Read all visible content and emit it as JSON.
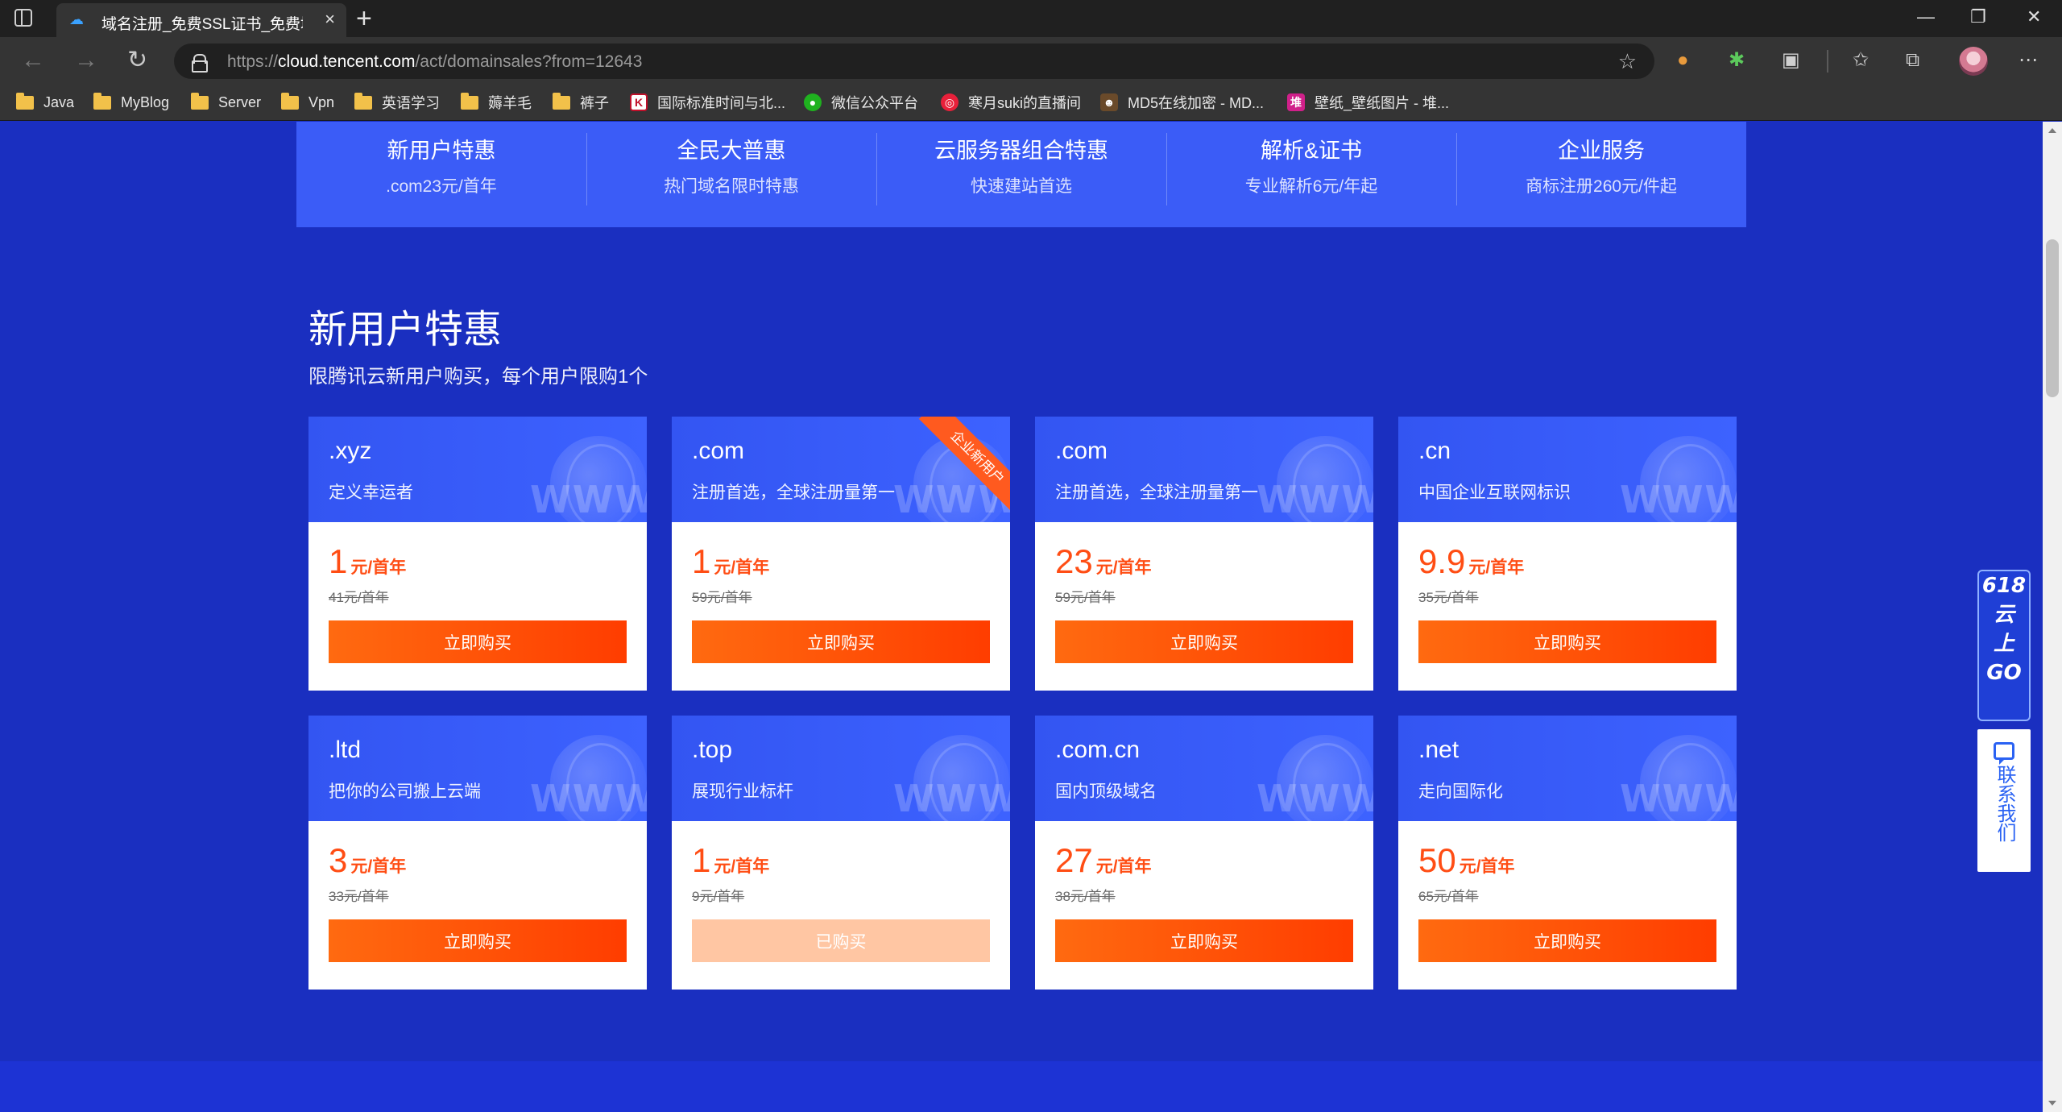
{
  "browser": {
    "tab_title": "域名注册_免费SSL证书_免费域名",
    "tab_close": "×",
    "new_tab": "+",
    "window": {
      "minimize": "—",
      "restore": "❐",
      "close": "✕"
    },
    "nav": {
      "back": "←",
      "forward": "→",
      "reload": "↻"
    },
    "url_scheme": "https://",
    "url_host": "cloud.tencent.com",
    "url_path": "/act/domainsales?from=12643",
    "bookmarks": [
      {
        "label": "Java",
        "icon": "folder-icon"
      },
      {
        "label": "MyBlog",
        "icon": "folder-icon"
      },
      {
        "label": "Server",
        "icon": "folder-icon"
      },
      {
        "label": "Vpn",
        "icon": "folder-icon"
      },
      {
        "label": "英语学习",
        "icon": "folder-icon"
      },
      {
        "label": "薅羊毛",
        "icon": "folder-icon"
      },
      {
        "label": "裤子",
        "icon": "folder-icon"
      },
      {
        "label": "国际标准时间与北...",
        "icon": "k-site-icon"
      },
      {
        "label": "微信公众平台",
        "icon": "wechat-icon"
      },
      {
        "label": "寒月suki的直播间",
        "icon": "live-icon"
      },
      {
        "label": "MD5在线加密 - MD...",
        "icon": "md5-site-icon"
      },
      {
        "label": "壁纸_壁纸图片 - 堆...",
        "icon": "wallpaper-site-icon"
      }
    ]
  },
  "category_nav": [
    {
      "title": "新用户特惠",
      "sub": ".com23元/首年"
    },
    {
      "title": "全民大普惠",
      "sub": "热门域名限时特惠"
    },
    {
      "title": "云服务器组合特惠",
      "sub": "快速建站首选"
    },
    {
      "title": "解析&证书",
      "sub": "专业解析6元/年起"
    },
    {
      "title": "企业服务",
      "sub": "商标注册260元/件起"
    }
  ],
  "section": {
    "title": "新用户特惠",
    "subtitle": "限腾讯云新用户购买，每个用户限购1个"
  },
  "cards": [
    {
      "domain": ".xyz",
      "desc": "定义幸运者",
      "price": "1",
      "unit": "元/首年",
      "orig": "41元/首年",
      "button": "立即购买",
      "watermark": "WWW"
    },
    {
      "domain": ".com",
      "desc": "注册首选，全球注册量第一",
      "price": "1",
      "unit": "元/首年",
      "orig": "59元/首年",
      "button": "立即购买",
      "ribbon": "企业新用户",
      "watermark": "WWW"
    },
    {
      "domain": ".com",
      "desc": "注册首选，全球注册量第一",
      "price": "23",
      "unit": "元/首年",
      "orig": "59元/首年",
      "button": "立即购买",
      "watermark": "WWW"
    },
    {
      "domain": ".cn",
      "desc": "中国企业互联网标识",
      "price": "9.9",
      "unit": "元/首年",
      "orig": "35元/首年",
      "button": "立即购买",
      "watermark": "WWW"
    },
    {
      "domain": ".ltd",
      "desc": "把你的公司搬上云端",
      "price": "3",
      "unit": "元/首年",
      "orig": "33元/首年",
      "button": "立即购买",
      "watermark": "WWW"
    },
    {
      "domain": ".top",
      "desc": "展现行业标杆",
      "price": "1",
      "unit": "元/首年",
      "orig": "9元/首年",
      "button": "已购买",
      "watermark": "WWW"
    },
    {
      "domain": ".com.cn",
      "desc": "国内顶级域名",
      "price": "27",
      "unit": "元/首年",
      "orig": "38元/首年",
      "button": "立即购买",
      "watermark": "WWW"
    },
    {
      "domain": ".net",
      "desc": "走向国际化",
      "price": "50",
      "unit": "元/首年",
      "orig": "65元/首年",
      "button": "立即购买",
      "watermark": "WWW"
    }
  ],
  "float": {
    "promo_lines": [
      "618",
      "云",
      "上",
      "GO"
    ],
    "contact": "联系我们"
  },
  "colors": {
    "page_bg": "#1a2fc0",
    "card_head": "#3b5cf7",
    "price": "#ff4d14",
    "button": "#ff5a10",
    "button_disabled": "#ffc6a3"
  }
}
